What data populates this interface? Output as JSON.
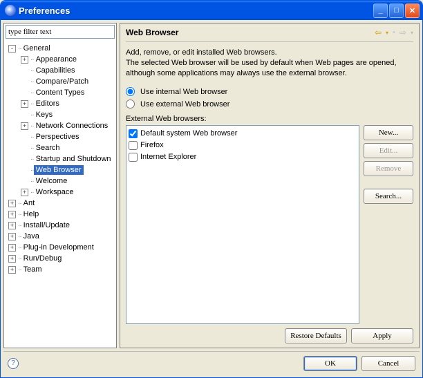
{
  "window": {
    "title": "Preferences"
  },
  "filter": {
    "value": "type filter text"
  },
  "tree": {
    "items": [
      {
        "depth": 0,
        "expander": "-",
        "label": "General",
        "selected": false
      },
      {
        "depth": 1,
        "expander": "+",
        "label": "Appearance"
      },
      {
        "depth": 1,
        "expander": "",
        "label": "Capabilities"
      },
      {
        "depth": 1,
        "expander": "",
        "label": "Compare/Patch"
      },
      {
        "depth": 1,
        "expander": "",
        "label": "Content Types"
      },
      {
        "depth": 1,
        "expander": "+",
        "label": "Editors"
      },
      {
        "depth": 1,
        "expander": "",
        "label": "Keys"
      },
      {
        "depth": 1,
        "expander": "+",
        "label": "Network Connections"
      },
      {
        "depth": 1,
        "expander": "",
        "label": "Perspectives"
      },
      {
        "depth": 1,
        "expander": "",
        "label": "Search"
      },
      {
        "depth": 1,
        "expander": "",
        "label": "Startup and Shutdown"
      },
      {
        "depth": 1,
        "expander": "",
        "label": "Web Browser",
        "selected": true
      },
      {
        "depth": 1,
        "expander": "",
        "label": "Welcome"
      },
      {
        "depth": 1,
        "expander": "+",
        "label": "Workspace"
      },
      {
        "depth": 0,
        "expander": "+",
        "label": "Ant"
      },
      {
        "depth": 0,
        "expander": "+",
        "label": "Help"
      },
      {
        "depth": 0,
        "expander": "+",
        "label": "Install/Update"
      },
      {
        "depth": 0,
        "expander": "+",
        "label": "Java"
      },
      {
        "depth": 0,
        "expander": "+",
        "label": "Plug-in Development"
      },
      {
        "depth": 0,
        "expander": "+",
        "label": "Run/Debug"
      },
      {
        "depth": 0,
        "expander": "+",
        "label": "Team"
      }
    ]
  },
  "page": {
    "title": "Web Browser",
    "description": "Add, remove, or edit installed Web browsers.\nThe selected Web browser will be used by default when Web pages are opened, although some applications may always use the external browser.",
    "radio_internal": "Use internal Web browser",
    "radio_external": "Use external Web browser",
    "radio_selected": "internal",
    "external_label": "External Web browsers:",
    "browsers": [
      {
        "label": "Default system Web browser",
        "checked": true
      },
      {
        "label": "Firefox",
        "checked": false
      },
      {
        "label": "Internet Explorer",
        "checked": false
      }
    ],
    "buttons": {
      "new": "New...",
      "edit": "Edit...",
      "remove": "Remove",
      "search": "Search...",
      "restore": "Restore Defaults",
      "apply": "Apply"
    }
  },
  "dialog": {
    "ok": "OK",
    "cancel": "Cancel"
  }
}
